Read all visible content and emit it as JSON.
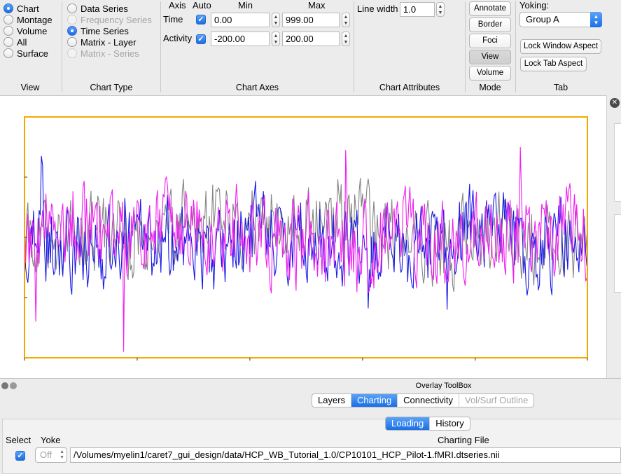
{
  "view_panel": {
    "title": "View",
    "options": [
      {
        "label": "Chart",
        "selected": true
      },
      {
        "label": "Montage",
        "selected": false
      },
      {
        "label": "Volume",
        "selected": false
      },
      {
        "label": "All",
        "selected": false
      },
      {
        "label": "Surface",
        "selected": false
      }
    ]
  },
  "chart_type_panel": {
    "title": "Chart Type",
    "options": [
      {
        "label": "Data Series",
        "selected": false,
        "enabled": true
      },
      {
        "label": "Frequency Series",
        "selected": false,
        "enabled": false
      },
      {
        "label": "Time Series",
        "selected": true,
        "enabled": true
      },
      {
        "label": "Matrix - Layer",
        "selected": false,
        "enabled": true
      },
      {
        "label": "Matrix - Series",
        "selected": false,
        "enabled": false
      }
    ]
  },
  "chart_axes_panel": {
    "title": "Chart Axes",
    "headers": {
      "axis": "Axis",
      "auto": "Auto",
      "min": "Min",
      "max": "Max"
    },
    "rows": [
      {
        "axis": "Time",
        "auto": true,
        "min": "0.00",
        "max": "999.00"
      },
      {
        "axis": "Activity",
        "auto": true,
        "min": "-200.00",
        "max": "200.00"
      }
    ]
  },
  "chart_attributes_panel": {
    "title": "Chart Attributes",
    "line_width_label": "Line width",
    "line_width_value": "1.0"
  },
  "mode_panel": {
    "title": "Mode",
    "buttons": [
      "Annotate",
      "Border",
      "Foci",
      "View",
      "Volume"
    ],
    "active": "View"
  },
  "tab_panel": {
    "title": "Tab",
    "yoking_label": "Yoking:",
    "yoking_value": "Group A",
    "lock_window_label": "Lock Window Aspect",
    "lock_tab_label": "Lock Tab Aspect"
  },
  "colors": {
    "frame": "#f5a800",
    "series_blue": "#1a1ae6",
    "series_magenta": "#f21ff2",
    "series_gray": "#858585",
    "accent": "#1a6fe5"
  },
  "chart_data": {
    "type": "line",
    "x_range": [
      0,
      999
    ],
    "y_range": [
      -200,
      200
    ],
    "grid": false,
    "series": [
      {
        "color": "#858585",
        "seed": 7,
        "amp": 52,
        "spikes": []
      },
      {
        "color": "#1a1ae6",
        "seed": 3,
        "amp": 58,
        "spikes": [
          [
            30,
            135
          ],
          [
            32,
            120
          ],
          [
            610,
            -118
          ],
          [
            750,
            -120
          ]
        ]
      },
      {
        "color": "#f21ff2",
        "seed": 11,
        "amp": 60,
        "spikes": [
          [
            20,
            -140
          ],
          [
            176,
            -190
          ],
          [
            327,
            145
          ],
          [
            509,
            195
          ],
          [
            570,
            145
          ],
          [
            880,
            150
          ]
        ]
      }
    ]
  },
  "overlay_toolbox": {
    "title": "Overlay ToolBox",
    "tabs": [
      {
        "label": "Layers",
        "active": false,
        "enabled": true
      },
      {
        "label": "Charting",
        "active": true,
        "enabled": true
      },
      {
        "label": "Connectivity",
        "active": false,
        "enabled": true
      },
      {
        "label": "Vol/Surf Outline",
        "active": false,
        "enabled": false
      }
    ],
    "sub_tabs": [
      {
        "label": "Loading",
        "active": true
      },
      {
        "label": "History",
        "active": false
      }
    ],
    "columns": {
      "select": "Select",
      "yoke": "Yoke",
      "file": "Charting File"
    },
    "row": {
      "selected": true,
      "yoke": "Off",
      "file_path": "/Volumes/myelin1/caret7_gui_design/data/HCP_WB_Tutorial_1.0/CP10101_HCP_Pilot-1.fMRI.dtseries.nii"
    }
  }
}
